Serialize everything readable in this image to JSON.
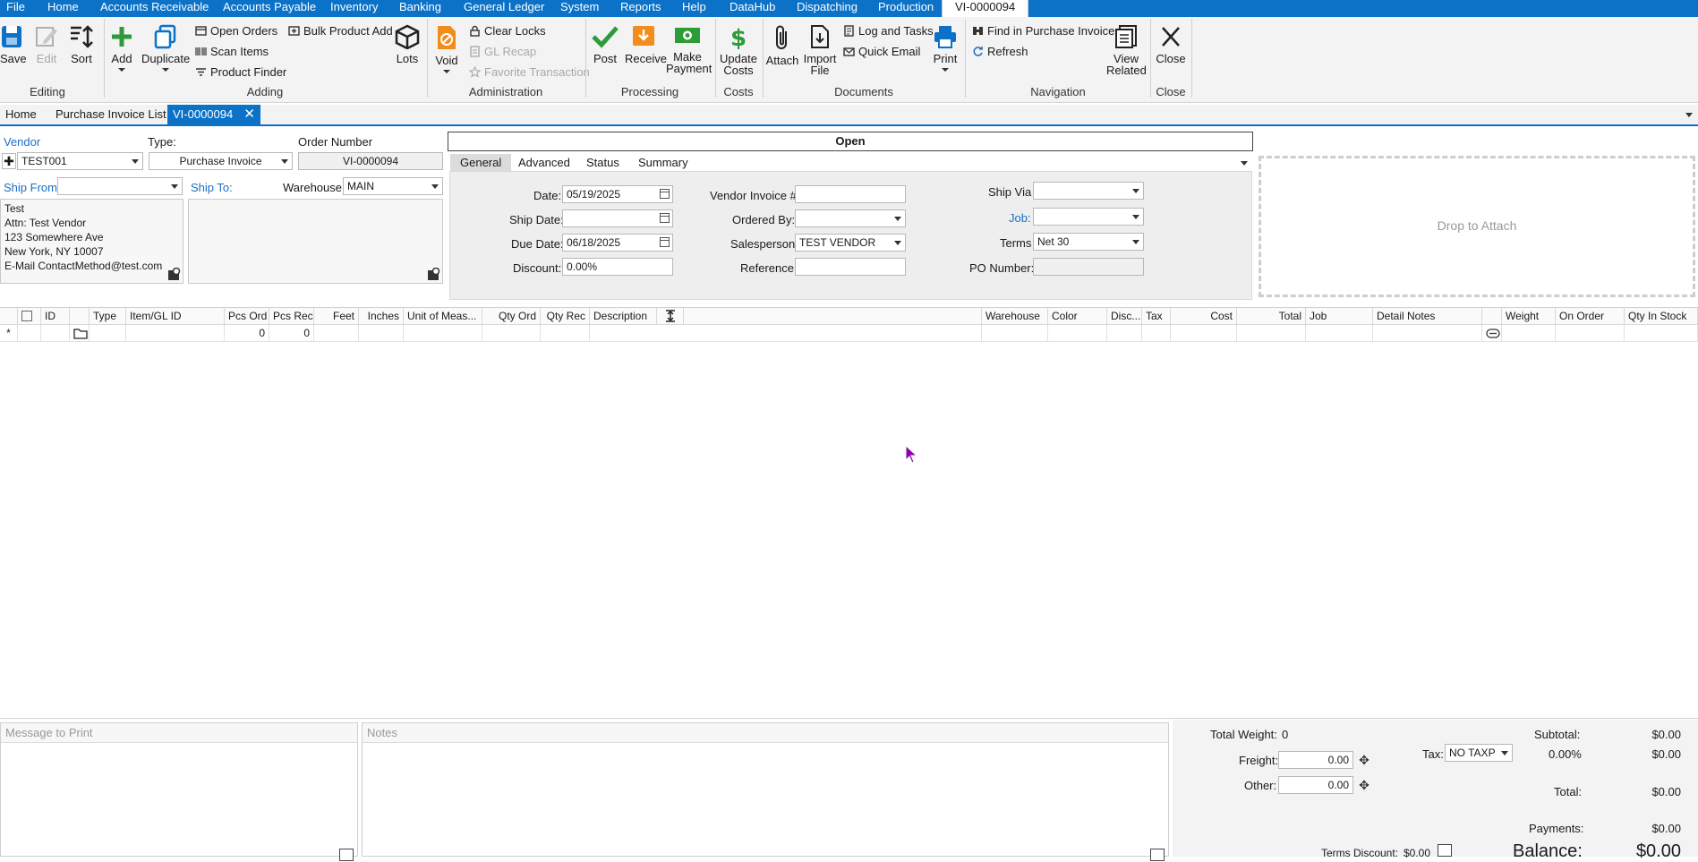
{
  "menu": {
    "items": [
      "File",
      "Home",
      "Accounts Receivable",
      "Accounts Payable",
      "Inventory",
      "Banking",
      "General Ledger",
      "System",
      "Reports",
      "Help",
      "DataHub",
      "Dispatching",
      "Production"
    ],
    "active_tab": "VI-0000094"
  },
  "ribbon": {
    "editing": {
      "save": "Save",
      "edit": "Edit",
      "sort": "Sort",
      "label": "Editing"
    },
    "adding": {
      "add": "Add",
      "duplicate": "Duplicate",
      "open_orders": "Open Orders",
      "scan_items": "Scan Items",
      "product_finder": "Product Finder",
      "bulk_product_add": "Bulk Product Add",
      "lots": "Lots",
      "label": "Adding"
    },
    "administration": {
      "void": "Void",
      "clear_locks": "Clear Locks",
      "gl_recap": "GL Recap",
      "favorite_transaction": "Favorite Transaction",
      "label": "Administration"
    },
    "processing": {
      "post": "Post",
      "receive": "Receive",
      "make_payment_1": "Make",
      "make_payment_2": "Payment",
      "label": "Processing"
    },
    "costs": {
      "update_costs_1": "Update",
      "update_costs_2": "Costs",
      "label": "Costs"
    },
    "documents": {
      "attach": "Attach",
      "import_file_1": "Import",
      "import_file_2": "File",
      "log_and_tasks": "Log and Tasks",
      "quick_email": "Quick Email",
      "print": "Print",
      "label": "Documents"
    },
    "navigation": {
      "find_in_purchase_invoice": "Find in Purchase Invoice",
      "refresh": "Refresh",
      "view_related_1": "View",
      "view_related_2": "Related",
      "label": "Navigation"
    },
    "close": {
      "close": "Close",
      "label": "Close"
    }
  },
  "doc_tabs": {
    "home": "Home",
    "purchase_invoice_list": "Purchase Invoice List",
    "current": "VI-0000094"
  },
  "header": {
    "vendor_label": "Vendor",
    "vendor_value": "TEST001",
    "type_label": "Type:",
    "type_value": "Purchase Invoice",
    "order_number_label": "Order Number",
    "order_number_value": "VI-0000094",
    "status": "Open",
    "ship_from_label": "Ship From:",
    "ship_to_label": "Ship To:",
    "warehouse_label": "Warehouse:",
    "warehouse_value": "MAIN",
    "ship_from_address": [
      "Test",
      "Attn: Test Vendor",
      "123 Somewhere Ave",
      "New York, NY 10007",
      "E-Mail ContactMethod@test.com"
    ]
  },
  "inner_tabs": [
    "General",
    "Advanced",
    "Status",
    "Summary"
  ],
  "general": {
    "date_label": "Date:",
    "date_value": "05/19/2025",
    "ship_date_label": "Ship Date:",
    "ship_date_value": "",
    "due_date_label": "Due Date:",
    "due_date_value": "06/18/2025",
    "discount_label": "Discount:",
    "discount_value": "0.00%",
    "vendor_invoice_label": "Vendor Invoice #",
    "vendor_invoice_value": "",
    "ordered_by_label": "Ordered By:",
    "ordered_by_value": "",
    "salesperson_label": "Salesperson:",
    "salesperson_value": "TEST VENDOR",
    "reference_label": "Reference:",
    "reference_value": "",
    "ship_via_label": "Ship Via",
    "ship_via_value": "",
    "job_label": "Job:",
    "job_value": "",
    "terms_label": "Terms",
    "terms_value": "Net 30",
    "po_number_label": "PO Number:",
    "po_number_value": ""
  },
  "drop_attach": "Drop to Attach",
  "grid": {
    "columns": [
      "ID",
      "Type",
      "Item/GL ID",
      "Pcs Ord",
      "Pcs Rec",
      "Feet",
      "Inches",
      "Unit of Meas...",
      "Qty Ord",
      "Qty Rec",
      "Description",
      "Warehouse",
      "Color",
      "Disc...",
      "Tax",
      "Cost",
      "Total",
      "Job",
      "Detail Notes",
      "Weight",
      "On Order",
      "Qty In Stock"
    ],
    "new_row": {
      "marker": "*",
      "pcs_ord": "0",
      "pcs_rec": "0"
    }
  },
  "bottom": {
    "message_to_print_label": "Message to Print",
    "notes_label": "Notes",
    "total_weight_label": "Total Weight:",
    "total_weight_value": "0",
    "freight_label": "Freight:",
    "freight_value": "0.00",
    "other_label": "Other:",
    "other_value": "0.00",
    "tax_label": "Tax:",
    "tax_value": "NO TAXP",
    "subtotal_label": "Subtotal:",
    "subtotal_value": "$0.00",
    "tax_percent": "0.00%",
    "tax_amount": "$0.00",
    "total_label": "Total:",
    "total_value": "$0.00",
    "payments_label": "Payments:",
    "payments_value": "$0.00",
    "terms_discount_label": "Terms Discount:",
    "terms_discount_value": "$0.00",
    "balance_label": "Balance:",
    "balance_value": "$0.00"
  },
  "colors": {
    "accent": "#0b72c7",
    "link": "#1a6fc4",
    "post_green": "#2e9a3a",
    "void_orange": "#f28c1b",
    "cursor": "#8e00a8"
  }
}
